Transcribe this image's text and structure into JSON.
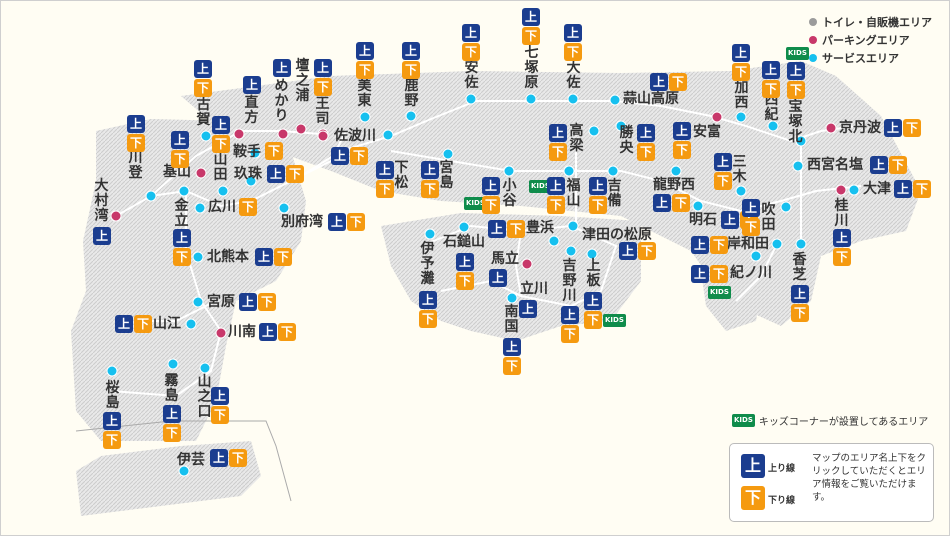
{
  "legend": {
    "items": [
      {
        "label": "トイレ・自販機エリア",
        "color": "#9b9b9b"
      },
      {
        "label": "パーキングエリア",
        "color": "#c8386a"
      },
      {
        "label": "サービスエリア",
        "color": "#16c0ef"
      }
    ],
    "kids_badge": "KIDS",
    "kids_text": "キッズコーナーが設置してあるエリア"
  },
  "guide": {
    "up_symbol": "上",
    "up_label": "上り線",
    "down_symbol": "下",
    "down_label": "下り線",
    "text": "マップのエリア名上下をクリックしていただくとエリア情報をご覧いただけます。"
  },
  "badges": {
    "up": "上",
    "down": "下",
    "kids": "KIDS"
  },
  "areas": [
    {
      "name": "大村湾",
      "type": "parking"
    },
    {
      "name": "川登",
      "type": "service"
    },
    {
      "name": "古賀",
      "type": "service"
    },
    {
      "name": "基山",
      "type": "parking"
    },
    {
      "name": "山田",
      "type": "service"
    },
    {
      "name": "直方",
      "type": "parking"
    },
    {
      "name": "めかり",
      "type": "parking"
    },
    {
      "name": "壇之浦",
      "type": "parking"
    },
    {
      "name": "王司",
      "type": "parking"
    },
    {
      "name": "美東",
      "type": "service"
    },
    {
      "name": "鹿野",
      "type": "service"
    },
    {
      "name": "安佐",
      "type": "service"
    },
    {
      "name": "七塚原",
      "type": "service"
    },
    {
      "name": "大佐",
      "type": "service"
    },
    {
      "name": "蒜山高原",
      "type": "service"
    },
    {
      "name": "加西",
      "type": "service"
    },
    {
      "name": "西紀",
      "type": "service"
    },
    {
      "name": "宝塚北",
      "type": "service"
    },
    {
      "name": "京丹波",
      "type": "parking"
    },
    {
      "name": "安富",
      "type": "parking"
    },
    {
      "name": "勝央",
      "type": "service"
    },
    {
      "name": "高梁",
      "type": "service"
    },
    {
      "name": "佐波川",
      "type": "parking"
    },
    {
      "name": "鞍手",
      "type": "service"
    },
    {
      "name": "玖珠",
      "type": "service"
    },
    {
      "name": "金立",
      "type": "service"
    },
    {
      "name": "広川",
      "type": "service"
    },
    {
      "name": "別府湾",
      "type": "service"
    },
    {
      "name": "下松",
      "type": "service"
    },
    {
      "name": "宮島",
      "type": "service"
    },
    {
      "name": "小谷",
      "type": "service"
    },
    {
      "name": "福山",
      "type": "service"
    },
    {
      "name": "吉備",
      "type": "service"
    },
    {
      "name": "龍野西",
      "type": "service"
    },
    {
      "name": "三木",
      "type": "service"
    },
    {
      "name": "西宮名塩",
      "type": "service"
    },
    {
      "name": "大津",
      "type": "service"
    },
    {
      "name": "桂川",
      "type": "parking"
    },
    {
      "name": "明石",
      "type": "service"
    },
    {
      "name": "吹田",
      "type": "service"
    },
    {
      "name": "岸和田",
      "type": "service"
    },
    {
      "name": "香芝",
      "type": "service"
    },
    {
      "name": "紀ノ川",
      "type": "service"
    },
    {
      "name": "石鎚山",
      "type": "service"
    },
    {
      "name": "豊浜",
      "type": "service"
    },
    {
      "name": "津田の松原",
      "type": "service"
    },
    {
      "name": "伊予灘",
      "type": "service"
    },
    {
      "name": "馬立",
      "type": "parking"
    },
    {
      "name": "立川",
      "type": "service"
    },
    {
      "name": "吉野川",
      "type": "service"
    },
    {
      "name": "上板",
      "type": "service"
    },
    {
      "name": "南国",
      "type": "service"
    },
    {
      "name": "北熊本",
      "type": "service"
    },
    {
      "name": "宮原",
      "type": "service"
    },
    {
      "name": "山江",
      "type": "service"
    },
    {
      "name": "川南",
      "type": "parking"
    },
    {
      "name": "桜島",
      "type": "service"
    },
    {
      "name": "霧島",
      "type": "service"
    },
    {
      "name": "山之口",
      "type": "service"
    },
    {
      "name": "伊芸",
      "type": "service"
    }
  ]
}
